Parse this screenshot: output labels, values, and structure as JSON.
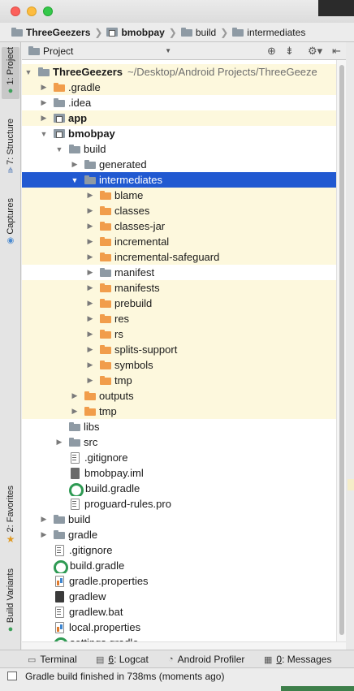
{
  "breadcrumb": [
    {
      "label": "ThreeGeezers",
      "icon": "project-folder-icon",
      "bold": true
    },
    {
      "label": "bmobpay",
      "icon": "module-folder-icon",
      "bold": true
    },
    {
      "label": "build",
      "icon": "folder-icon",
      "bold": false
    },
    {
      "label": "intermediates",
      "icon": "folder-icon",
      "bold": false
    }
  ],
  "left_tabs": {
    "project": "1: Project",
    "structure": "7: Structure",
    "captures": "Captures",
    "favorites": "2: Favorites",
    "build_variants": "Build Variants"
  },
  "panel_header": {
    "view_select": "Project",
    "icons": [
      "target-icon",
      "collapse-icon",
      "gear-icon",
      "hide-icon"
    ]
  },
  "tree": [
    {
      "label": "ThreeGeezers",
      "suffix": "~/Desktop/Android Projects/ThreeGeeze",
      "depth": 0,
      "expand": "open",
      "icon": "folder",
      "bold": true,
      "hl": true
    },
    {
      "label": ".gradle",
      "depth": 1,
      "expand": "closed",
      "icon": "folder-orange",
      "hl": true
    },
    {
      "label": ".idea",
      "depth": 1,
      "expand": "closed",
      "icon": "folder"
    },
    {
      "label": "app",
      "depth": 1,
      "expand": "closed",
      "icon": "module",
      "bold": true,
      "hl": true
    },
    {
      "label": "bmobpay",
      "depth": 1,
      "expand": "open",
      "icon": "module",
      "bold": true
    },
    {
      "label": "build",
      "depth": 2,
      "expand": "open",
      "icon": "folder"
    },
    {
      "label": "generated",
      "depth": 3,
      "expand": "closed",
      "icon": "folder"
    },
    {
      "label": "intermediates",
      "depth": 3,
      "expand": "open",
      "icon": "folder",
      "selected": true
    },
    {
      "label": "blame",
      "depth": 4,
      "expand": "closed",
      "icon": "folder-orange",
      "hl": true
    },
    {
      "label": "classes",
      "depth": 4,
      "expand": "closed",
      "icon": "folder-orange",
      "hl": true
    },
    {
      "label": "classes-jar",
      "depth": 4,
      "expand": "closed",
      "icon": "folder-orange",
      "hl": true
    },
    {
      "label": "incremental",
      "depth": 4,
      "expand": "closed",
      "icon": "folder-orange",
      "hl": true
    },
    {
      "label": "incremental-safeguard",
      "depth": 4,
      "expand": "closed",
      "icon": "folder-orange",
      "hl": true
    },
    {
      "label": "manifest",
      "depth": 4,
      "expand": "closed",
      "icon": "folder"
    },
    {
      "label": "manifests",
      "depth": 4,
      "expand": "closed",
      "icon": "folder-orange",
      "hl": true
    },
    {
      "label": "prebuild",
      "depth": 4,
      "expand": "closed",
      "icon": "folder-orange",
      "hl": true
    },
    {
      "label": "res",
      "depth": 4,
      "expand": "closed",
      "icon": "folder-orange",
      "hl": true
    },
    {
      "label": "rs",
      "depth": 4,
      "expand": "closed",
      "icon": "folder-orange",
      "hl": true
    },
    {
      "label": "splits-support",
      "depth": 4,
      "expand": "closed",
      "icon": "folder-orange",
      "hl": true
    },
    {
      "label": "symbols",
      "depth": 4,
      "expand": "closed",
      "icon": "folder-orange",
      "hl": true
    },
    {
      "label": "tmp",
      "depth": 4,
      "expand": "closed",
      "icon": "folder-orange",
      "hl": true
    },
    {
      "label": "outputs",
      "depth": 3,
      "expand": "closed",
      "icon": "folder-orange",
      "hl": true
    },
    {
      "label": "tmp",
      "depth": 3,
      "expand": "closed",
      "icon": "folder-orange",
      "hl": true
    },
    {
      "label": "libs",
      "depth": 2,
      "expand": "none",
      "icon": "folder"
    },
    {
      "label": "src",
      "depth": 2,
      "expand": "closed",
      "icon": "folder"
    },
    {
      "label": ".gitignore",
      "depth": 2,
      "expand": "none",
      "icon": "file-gitignore"
    },
    {
      "label": "bmobpay.iml",
      "depth": 2,
      "expand": "none",
      "icon": "file-iml"
    },
    {
      "label": "build.gradle",
      "depth": 2,
      "expand": "none",
      "icon": "file-gradle"
    },
    {
      "label": "proguard-rules.pro",
      "depth": 2,
      "expand": "none",
      "icon": "file-gitignore"
    },
    {
      "label": "build",
      "depth": 1,
      "expand": "closed",
      "icon": "folder"
    },
    {
      "label": "gradle",
      "depth": 1,
      "expand": "closed",
      "icon": "folder"
    },
    {
      "label": ".gitignore",
      "depth": 1,
      "expand": "none",
      "icon": "file-gitignore"
    },
    {
      "label": "build.gradle",
      "depth": 1,
      "expand": "none",
      "icon": "file-gradle"
    },
    {
      "label": "gradle.properties",
      "depth": 1,
      "expand": "none",
      "icon": "file-props"
    },
    {
      "label": "gradlew",
      "depth": 1,
      "expand": "none",
      "icon": "file-term"
    },
    {
      "label": "gradlew.bat",
      "depth": 1,
      "expand": "none",
      "icon": "file-gitignore"
    },
    {
      "label": "local.properties",
      "depth": 1,
      "expand": "none",
      "icon": "file-props"
    },
    {
      "label": "settings.gradle",
      "depth": 1,
      "expand": "none",
      "icon": "file-gradle"
    }
  ],
  "tool_windows": {
    "terminal": "Terminal",
    "logcat_num": "6",
    "logcat": ": Logcat",
    "profiler": "Android Profiler",
    "messages_num": "0",
    "messages": ": Messages"
  },
  "status": {
    "message": "Gradle build finished in 738ms (moments ago)"
  },
  "colors": {
    "selection": "#2159d1",
    "highlight_row": "#fdf8dd",
    "folder_orange": "#f19d4b",
    "folder_grey": "#8e9aa4"
  }
}
